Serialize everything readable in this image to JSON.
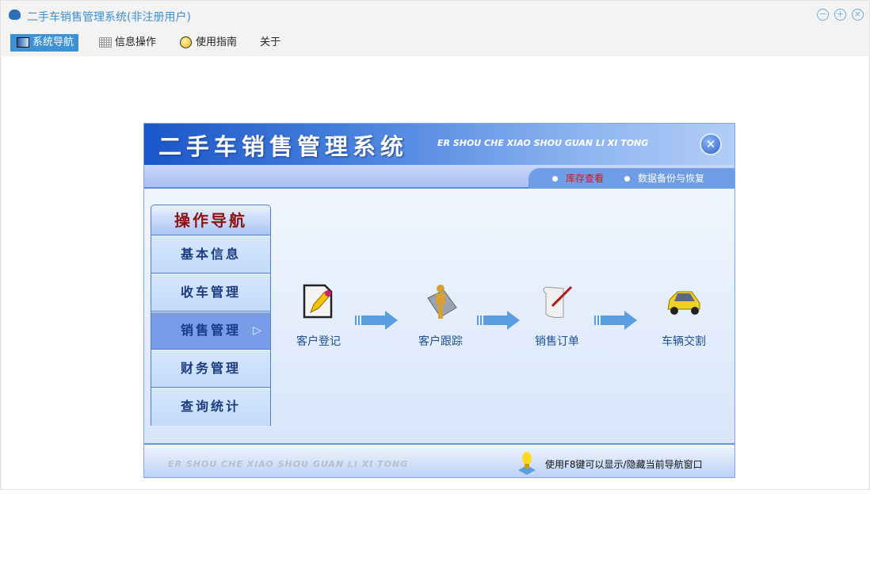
{
  "window": {
    "title": "二手车销售管理系统(非注册用户)",
    "controls": [
      "minimize",
      "maximize",
      "close"
    ]
  },
  "menu": [
    {
      "label": "系统导航",
      "icon": "monitor-icon",
      "active": true
    },
    {
      "label": "信息操作",
      "icon": "grid-icon"
    },
    {
      "label": "使用指南",
      "icon": "help-icon"
    },
    {
      "label": "关于"
    }
  ],
  "panel": {
    "title": "二手车销售管理系统",
    "subtitle": "ER SHOU CHE XIAO SHOU GUAN LI XI TONG",
    "links": [
      {
        "label": "库存查看",
        "color": "#e01010"
      },
      {
        "label": "数据备份与恢复",
        "color": "#ffffff"
      }
    ],
    "nav_title": "操作导航",
    "nav_items": [
      "基本信息",
      "收车管理",
      "销售管理",
      "财务管理",
      "查询统计"
    ],
    "selected_nav": "销售管理",
    "steps": [
      "客户登记",
      "客户跟踪",
      "销售订单",
      "车辆交割"
    ],
    "footer_sub": "ER SHOU CHE XIAO SHOU GUAN LI XI TONG",
    "footer_tip": "使用F8键可以显示/隐藏当前导航窗口"
  }
}
